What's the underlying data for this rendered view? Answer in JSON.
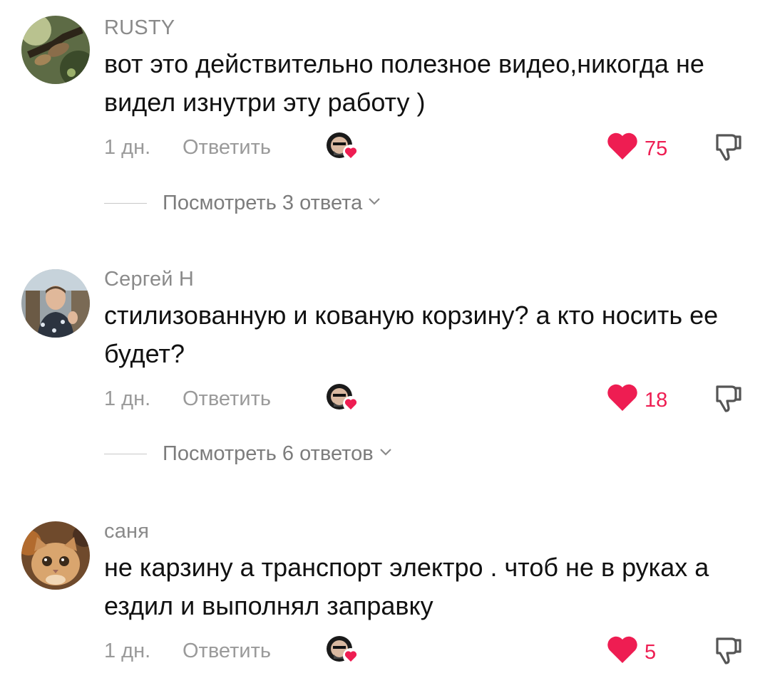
{
  "comments": [
    {
      "author": "RUSTY",
      "text": "вот это действительно полезное видео,никогда не видел изнутри эту работу )",
      "time": "1 дн.",
      "reply_label": "Ответить",
      "likes": "75",
      "view_replies": "Посмотреть 3 ответа",
      "avatar_icon": "avatar-moths-photo"
    },
    {
      "author": "Сергей Н",
      "text": "стилизованную и кованую корзину? а кто носить ее будет?",
      "time": "1 дн.",
      "reply_label": "Ответить",
      "likes": "18",
      "view_replies": "Посмотреть 6 ответов",
      "avatar_icon": "avatar-man-photo"
    },
    {
      "author": "саня",
      "text": "не карзину а транспорт электро . чтоб не в руках а ездил и выполнял заправку",
      "time": "1 дн.",
      "reply_label": "Ответить",
      "likes": "5",
      "avatar_icon": "avatar-cat-photo"
    }
  ],
  "colors": {
    "like_red": "#ee1d52",
    "meta_gray": "#9a9a9a",
    "text_black": "#111111"
  },
  "icons": {
    "like": "heart-icon",
    "dislike": "thumbs-down-icon",
    "creator_liked": "creator-liked-badge-icon",
    "expand": "chevron-down-icon"
  }
}
